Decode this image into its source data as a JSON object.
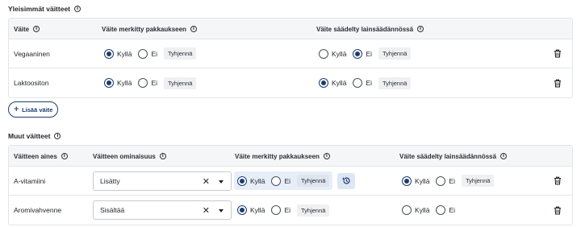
{
  "section1": {
    "title": "Yleisimmät väitteet",
    "headers": {
      "claim": "Väite",
      "marked": "Väite merkitty pakkaukseen",
      "regulated": "Väite säädelty lainsäädännössä"
    },
    "rows": [
      {
        "label": "Vegaaninen",
        "marked": "Kyllä",
        "regulated": "Ei"
      },
      {
        "label": "Laktoositon",
        "marked": "Kyllä",
        "regulated": "Kyllä"
      }
    ],
    "add_button": "Lisää väite"
  },
  "section2": {
    "title": "Muut väitteet",
    "headers": {
      "substance": "Väitteen aines",
      "property": "Väitteen ominaisuus",
      "marked": "Väite merkitty pakkaukseen",
      "regulated": "Väite säädelty lainsäädännössä"
    },
    "rows": [
      {
        "label": "A-vitamiini",
        "property": "Lisätty",
        "marked": "Kyllä",
        "regulated": "Kyllä"
      },
      {
        "label": "Aromivahvenne",
        "property": "Sisältää",
        "marked": "Kyllä",
        "regulated": ""
      }
    ]
  },
  "common": {
    "yes": "Kyllä",
    "no": "Ei",
    "clear": "Tyhjennä",
    "info": "i"
  },
  "colors": {
    "accent": "#1d3c6e",
    "header_bg": "#f5f6f8",
    "highlight_bg": "#e8eef8"
  },
  "icons": [
    "info-icon",
    "trash-icon",
    "plus-icon",
    "clear-x-icon",
    "caret-down-icon",
    "history-reset-icon"
  ]
}
